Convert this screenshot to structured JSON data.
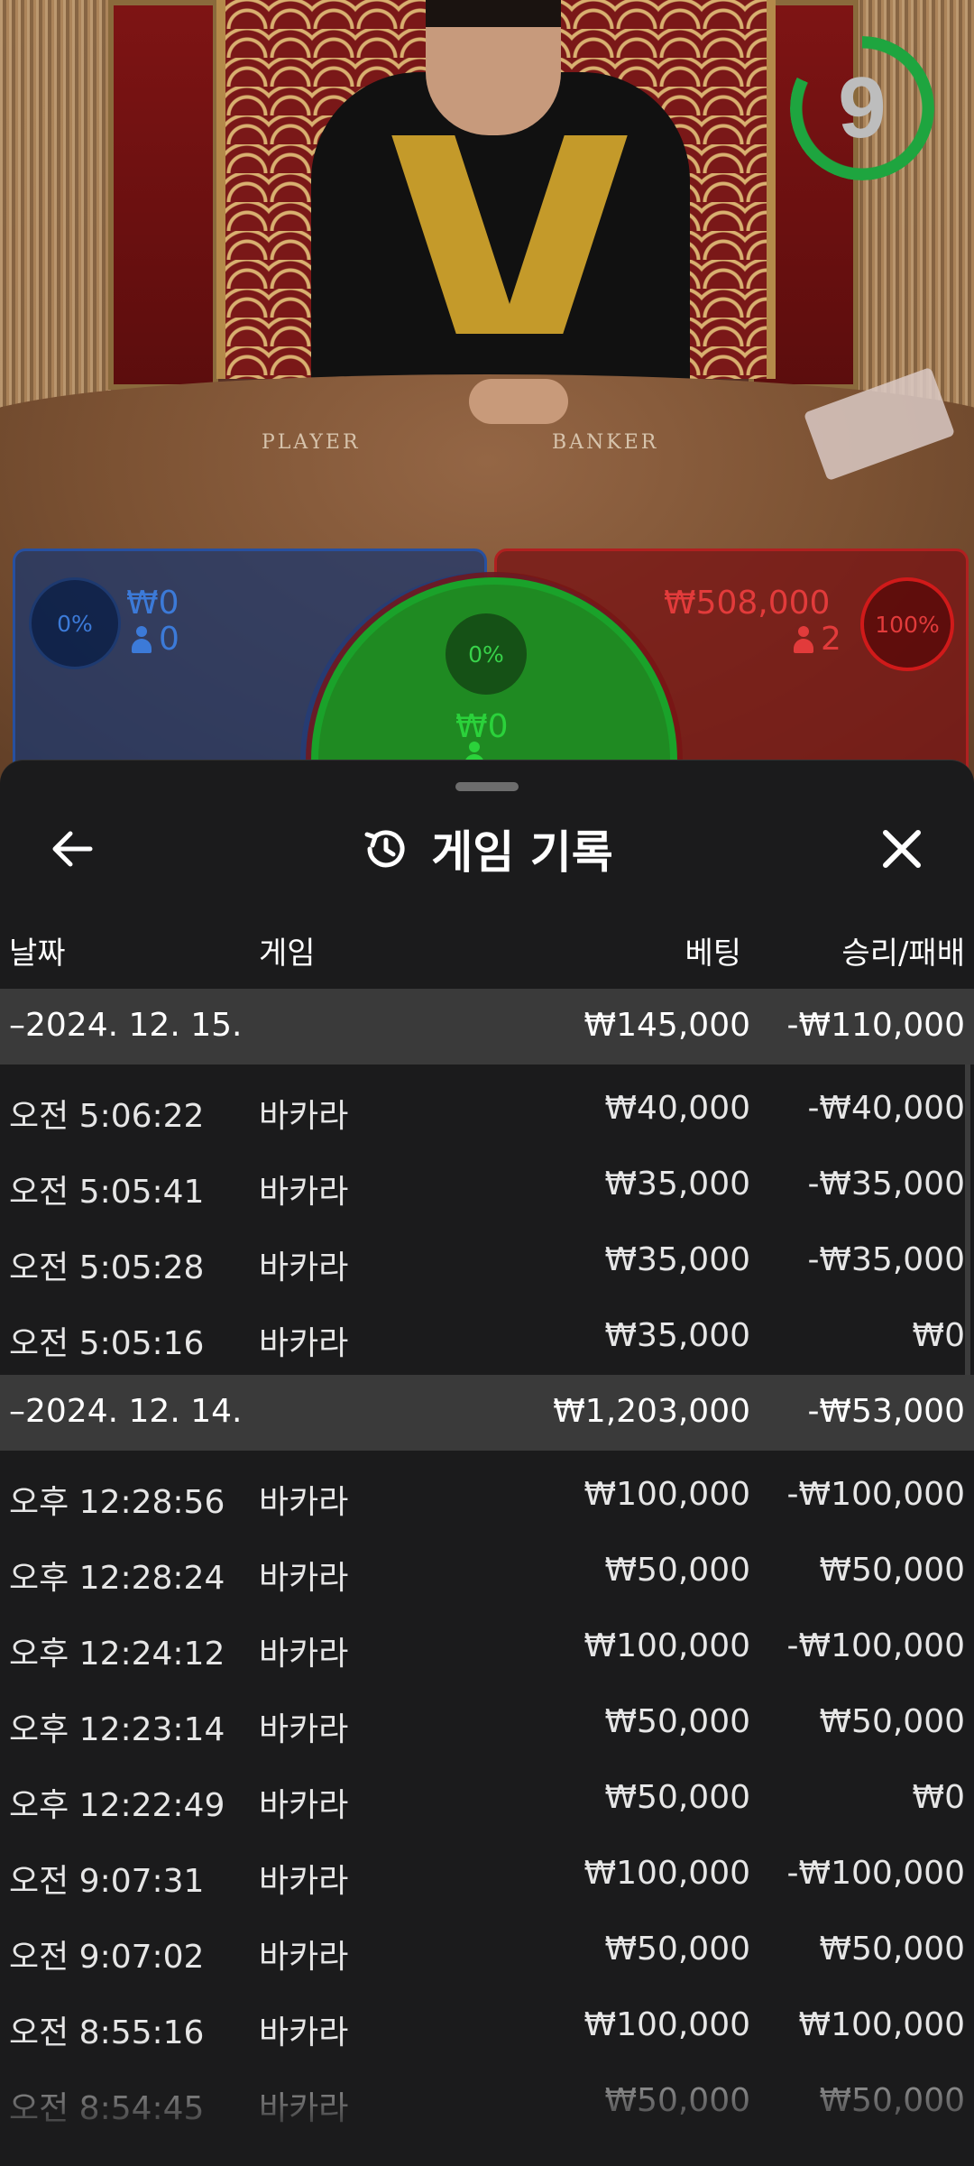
{
  "table": {
    "player_label": "PLAYER",
    "banker_label": "BANKER"
  },
  "timer": {
    "value": "9",
    "progress": 0.82,
    "color": "#1ea53f"
  },
  "bets": {
    "player": {
      "percent": "0%",
      "amount": "₩0",
      "count": "0",
      "color": "#3c7ad8"
    },
    "tie": {
      "percent": "0%",
      "amount": "₩0",
      "color": "#2bd23b"
    },
    "banker": {
      "percent": "100%",
      "amount": "₩508,000",
      "count": "2",
      "color": "#e23b3b"
    }
  },
  "sheet": {
    "title": "게임 기록",
    "back_icon": "arrow-left-icon",
    "history_icon": "history-clock-icon",
    "close_icon": "close-icon",
    "columns": {
      "date": "날짜",
      "game": "게임",
      "bet": "베팅",
      "result": "승리/패배"
    },
    "rows": [
      {
        "type": "group",
        "date": "–2024. 12. 15.",
        "game": "",
        "bet": "₩145,000",
        "result": "-₩110,000"
      },
      {
        "type": "item",
        "date": "오전 5:06:22",
        "game": "바카라",
        "bet": "₩40,000",
        "result": "-₩40,000"
      },
      {
        "type": "item",
        "date": "오전 5:05:41",
        "game": "바카라",
        "bet": "₩35,000",
        "result": "-₩35,000"
      },
      {
        "type": "item",
        "date": "오전 5:05:28",
        "game": "바카라",
        "bet": "₩35,000",
        "result": "-₩35,000"
      },
      {
        "type": "item",
        "date": "오전 5:05:16",
        "game": "바카라",
        "bet": "₩35,000",
        "result": "₩0"
      },
      {
        "type": "group",
        "date": "–2024. 12. 14.",
        "game": "",
        "bet": "₩1,203,000",
        "result": "-₩53,000"
      },
      {
        "type": "item",
        "date": "오후 12:28:56",
        "game": "바카라",
        "bet": "₩100,000",
        "result": "-₩100,000"
      },
      {
        "type": "item",
        "date": "오후 12:28:24",
        "game": "바카라",
        "bet": "₩50,000",
        "result": "₩50,000"
      },
      {
        "type": "item",
        "date": "오후 12:24:12",
        "game": "바카라",
        "bet": "₩100,000",
        "result": "-₩100,000"
      },
      {
        "type": "item",
        "date": "오후 12:23:14",
        "game": "바카라",
        "bet": "₩50,000",
        "result": "₩50,000"
      },
      {
        "type": "item",
        "date": "오후 12:22:49",
        "game": "바카라",
        "bet": "₩50,000",
        "result": "₩0"
      },
      {
        "type": "item",
        "date": "오전 9:07:31",
        "game": "바카라",
        "bet": "₩100,000",
        "result": "-₩100,000"
      },
      {
        "type": "item",
        "date": "오전 9:07:02",
        "game": "바카라",
        "bet": "₩50,000",
        "result": "₩50,000"
      },
      {
        "type": "item",
        "date": "오전 8:55:16",
        "game": "바카라",
        "bet": "₩100,000",
        "result": "₩100,000"
      },
      {
        "type": "item",
        "date": "오전 8:54:45",
        "game": "바카라",
        "bet": "₩50,000",
        "result": "₩50,000"
      }
    ]
  }
}
